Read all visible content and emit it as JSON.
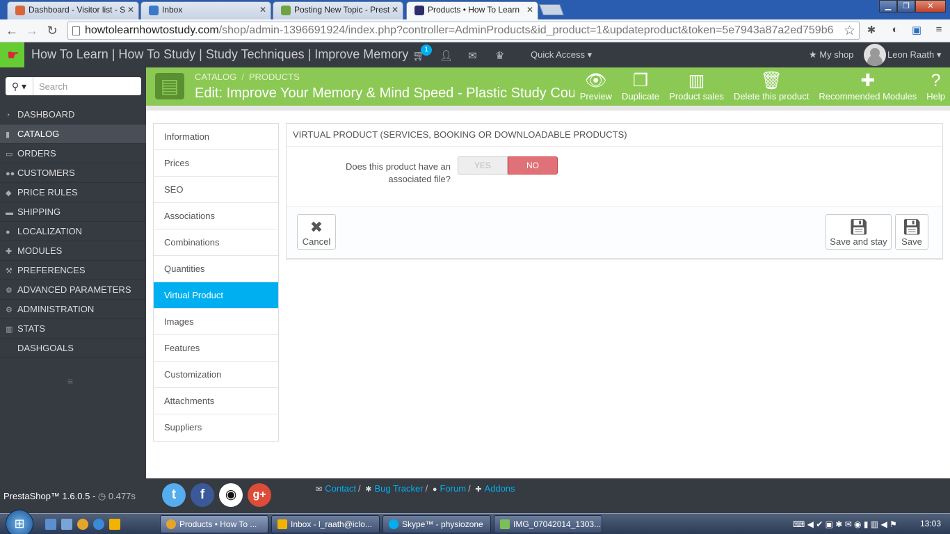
{
  "browser": {
    "tabs": [
      {
        "label": "Dashboard - Visitor list - S",
        "color": "#d9663a"
      },
      {
        "label": "Inbox",
        "color": "#3a78c9"
      },
      {
        "label": "Posting New Topic - Prest",
        "color": "#6ea440"
      },
      {
        "label": "Products • How To Learn",
        "color": "#2c2f6b"
      }
    ],
    "url_host": "howtolearnhowtostudy.com",
    "url_path": "/shop/admin-1396691924/index.php?controller=AdminProducts&id_product=1&updateproduct&token=5e7943a87a2ed759b6"
  },
  "admin_header": {
    "shop_name": "How To Learn | How To Study | Study Techniques | Improve Memory",
    "cart_badge": "1",
    "quick_access": "Quick Access",
    "my_shop": "My shop",
    "user_name": "Leon Raath"
  },
  "sidebar": {
    "search_placeholder": "Search",
    "items": [
      {
        "label": "DASHBOARD",
        "icon": "dashboard-icon"
      },
      {
        "label": "CATALOG",
        "icon": "book-icon"
      },
      {
        "label": "ORDERS",
        "icon": "credit-card-icon"
      },
      {
        "label": "CUSTOMERS",
        "icon": "users-icon"
      },
      {
        "label": "PRICE RULES",
        "icon": "tag-icon"
      },
      {
        "label": "SHIPPING",
        "icon": "truck-icon"
      },
      {
        "label": "LOCALIZATION",
        "icon": "globe-icon"
      },
      {
        "label": "MODULES",
        "icon": "puzzle-icon"
      },
      {
        "label": "PREFERENCES",
        "icon": "wrench-icon"
      },
      {
        "label": "ADVANCED PARAMETERS",
        "icon": "cogs-icon"
      },
      {
        "label": "ADMINISTRATION",
        "icon": "gear-icon"
      },
      {
        "label": "STATS",
        "icon": "bar-chart-icon"
      },
      {
        "label": "DASHGOALS",
        "icon": ""
      }
    ]
  },
  "toolbar": {
    "breadcrumb_catalog": "CATALOG",
    "breadcrumb_products": "PRODUCTS",
    "title": "Edit: Improve Your Memory & Mind Speed - Plastic Study Course",
    "buttons": [
      {
        "label": "Preview",
        "icon": "eye-icon"
      },
      {
        "label": "Duplicate",
        "icon": "copy-icon"
      },
      {
        "label": "Product sales",
        "icon": "bar-chart-icon"
      },
      {
        "label": "Delete this product",
        "icon": "trash-icon"
      },
      {
        "label": "Recommended Modules",
        "icon": "puzzle-icon"
      },
      {
        "label": "Help",
        "icon": "question-icon"
      }
    ]
  },
  "product_tabs": [
    "Information",
    "Prices",
    "SEO",
    "Associations",
    "Combinations",
    "Quantities",
    "Virtual Product",
    "Images",
    "Features",
    "Customization",
    "Attachments",
    "Suppliers"
  ],
  "panel": {
    "heading": "VIRTUAL PRODUCT (SERVICES, BOOKING OR DOWNLOADABLE PRODUCTS)",
    "question": "Does this product have an associated file?",
    "switch_yes": "YES",
    "switch_no": "NO",
    "cancel": "Cancel",
    "save_and_stay": "Save and stay",
    "save": "Save"
  },
  "footer": {
    "version": "PrestaShop™ 1.6.0.5",
    "separator": "-",
    "load_time": "0.477s",
    "links": {
      "contact": "Contact",
      "bug_tracker": "Bug Tracker",
      "forum": "Forum",
      "addons": "Addons"
    }
  },
  "taskbar": {
    "tasks": [
      "Products • How To ...",
      "Inbox - l_raath@iclo...",
      "Skype™ - physiozone",
      "IMG_07042014_1303..."
    ],
    "clock": "13:03"
  }
}
